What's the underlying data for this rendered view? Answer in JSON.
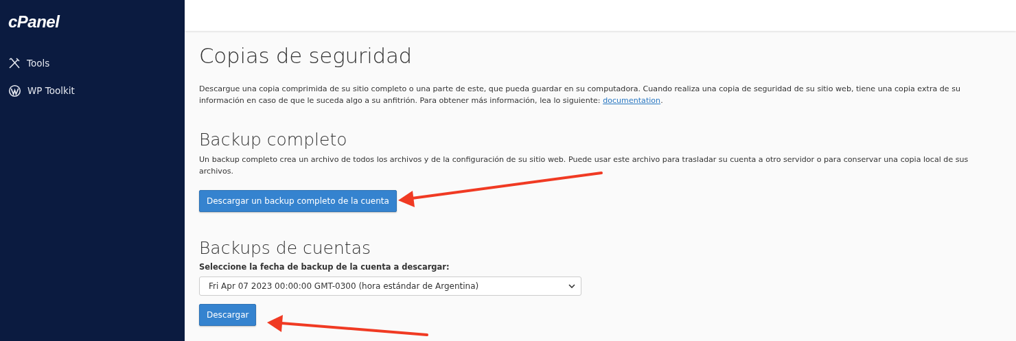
{
  "sidebar": {
    "logo": "cPanel",
    "items": [
      {
        "label": "Tools",
        "kind": "tools"
      },
      {
        "label": "WP Toolkit",
        "kind": "wordpress"
      }
    ]
  },
  "page_title": "Copias de seguridad",
  "intro": {
    "text": "Descargue una copia comprimida de su sitio completo o una parte de este, que pueda guardar en su computadora. Cuando realiza una copia de seguridad de su sitio web, tiene una copia extra de su información en caso de que le suceda algo a su anfitrión. Para obtener más información, lea lo siguiente:",
    "link": "documentation",
    "after": "."
  },
  "full_backup": {
    "heading": "Backup completo",
    "text": "Un backup completo crea un archivo de todos los archivos y de la configuración de su sitio web. Puede usar este archivo para trasladar su cuenta a otro servidor o para conservar una copia local de sus archivos.",
    "button": "Descargar un backup completo de la cuenta"
  },
  "account_backups": {
    "heading": "Backups de cuentas",
    "label": "Seleccione la fecha de backup de la cuenta a descargar:",
    "value": "Fri Apr 07 2023 00:00:00 GMT-0300 (hora estándar de Argentina)",
    "button": "Descargar"
  }
}
